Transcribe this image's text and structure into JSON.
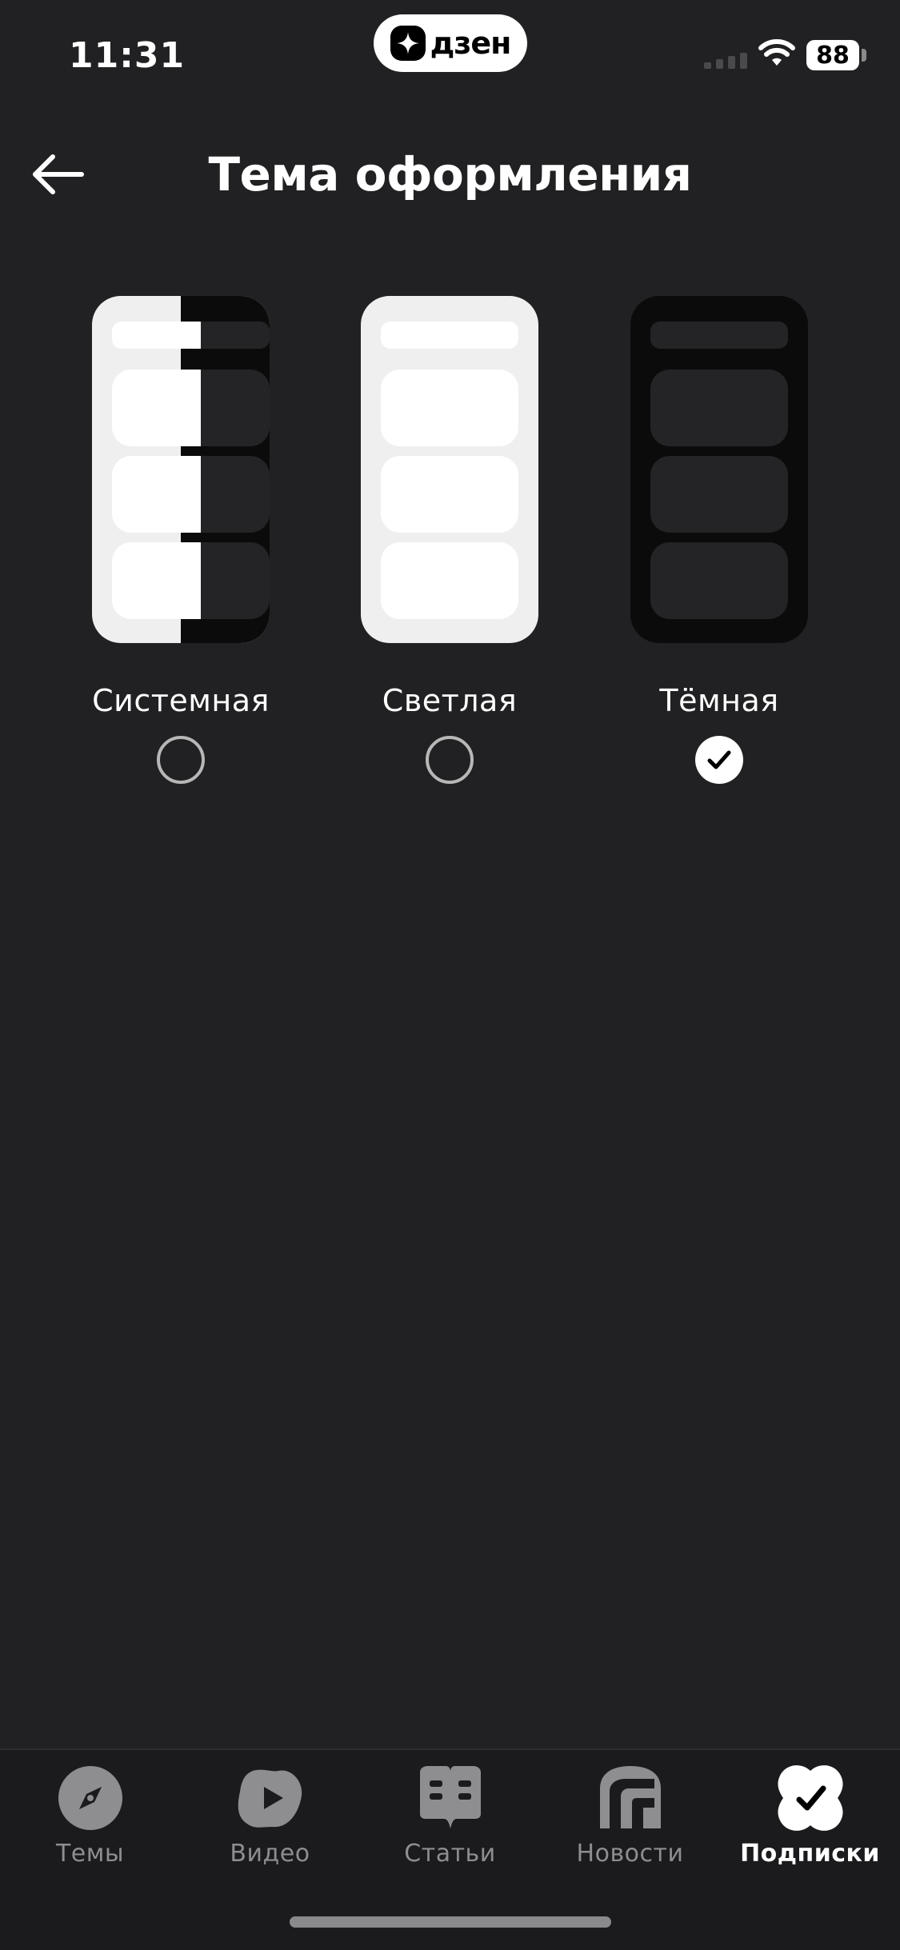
{
  "status_bar": {
    "time": "11:31",
    "app_badge": "дзен",
    "battery": "88"
  },
  "header": {
    "title": "Тема оформления"
  },
  "themes": [
    {
      "label": "Системная",
      "selected": false
    },
    {
      "label": "Светлая",
      "selected": false
    },
    {
      "label": "Тёмная",
      "selected": true
    }
  ],
  "tab_bar": {
    "items": [
      {
        "label": "Темы",
        "icon": "compass-icon",
        "active": false
      },
      {
        "label": "Видео",
        "icon": "play-icon",
        "active": false
      },
      {
        "label": "Статьи",
        "icon": "book-icon",
        "active": false
      },
      {
        "label": "Новости",
        "icon": "news-icon",
        "active": false
      },
      {
        "label": "Подписки",
        "icon": "subscriptions-check-icon",
        "active": true
      }
    ]
  },
  "colors": {
    "background": "#212123",
    "tab_bar": "#1b1b1d",
    "accent": "#ffffff",
    "inactive": "#8e8e90"
  }
}
